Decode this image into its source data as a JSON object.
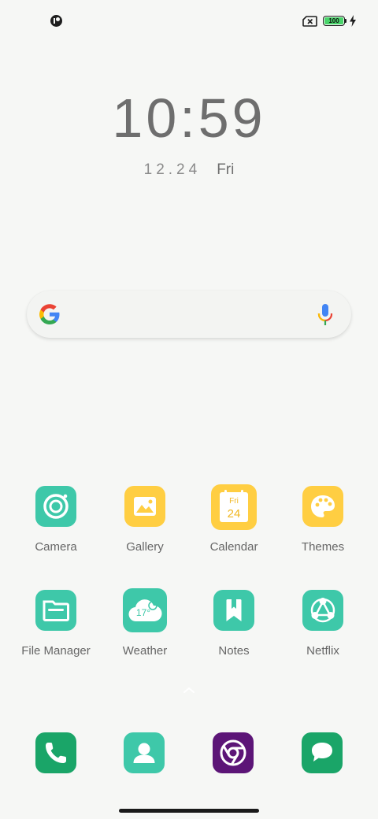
{
  "status_bar": {
    "battery_level": "100",
    "icons": [
      "app-notification-icon",
      "no-sim-icon",
      "battery-icon",
      "charging-bolt-icon"
    ]
  },
  "clock": {
    "time": "10:59",
    "date": "12.24",
    "weekday": "Fri"
  },
  "search": {
    "provider_icon": "google-g-icon",
    "mic_icon": "microphone-icon"
  },
  "apps": [
    {
      "label": "Camera",
      "icon": "camera-icon",
      "color": "#3ec8a9"
    },
    {
      "label": "Gallery",
      "icon": "gallery-icon",
      "color": "#ffce42"
    },
    {
      "label": "Calendar",
      "icon": "calendar-icon",
      "color": "#ffce42",
      "icon_text_day": "Fri",
      "icon_text_date": "24"
    },
    {
      "label": "Themes",
      "icon": "palette-icon",
      "color": "#ffce42"
    },
    {
      "label": "File Manager",
      "icon": "folder-icon",
      "color": "#3ec8a9"
    },
    {
      "label": "Weather",
      "icon": "weather-icon",
      "color": "#3ec8a9",
      "icon_text_temp": "17°"
    },
    {
      "label": "Notes",
      "icon": "bookmark-icon",
      "color": "#3ec8a9"
    },
    {
      "label": "Netflix",
      "icon": "share-icon",
      "color": "#3ec8a9"
    }
  ],
  "dock": [
    {
      "icon": "phone-icon",
      "color": "#1aa568"
    },
    {
      "icon": "contacts-icon",
      "color": "#3ec8a9"
    },
    {
      "icon": "chrome-icon",
      "color": "#5c1577"
    },
    {
      "icon": "messages-icon",
      "color": "#1aa568"
    }
  ]
}
